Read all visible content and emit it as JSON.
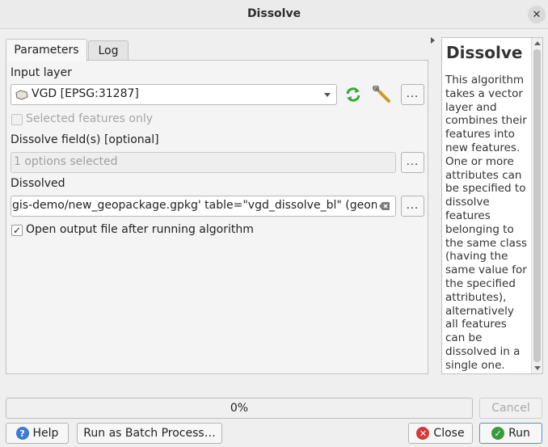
{
  "window": {
    "title": "Dissolve",
    "close_symbol": "✕"
  },
  "tabs": [
    "Parameters",
    "Log"
  ],
  "parameters": {
    "input_layer_label": "Input layer",
    "input_layer_value": "VGD [EPSG:31287]",
    "selected_only_label": "Selected features only",
    "dissolve_field_label": "Dissolve field(s) [optional]",
    "dissolve_field_placeholder": "1 options selected",
    "output_label": "Dissolved",
    "output_value": "gis-demo/new_geopackage.gpkg' table=\"vgd_dissolve_bl\" (geom)",
    "open_output_label": "Open output file after running algorithm",
    "open_output_checked": true,
    "browse_label": "..."
  },
  "help_panel": {
    "title": "Dissolve",
    "text": "This algorithm takes a vector layer and combines their features into new features. One or more attributes can be specified to dissolve features belonging to the same class (having the same value for the specified attributes), alternatively all features can be dissolved in a single one."
  },
  "progress": {
    "label": "0%",
    "value": 0
  },
  "buttons": {
    "cancel": "Cancel",
    "help": "Help",
    "batch": "Run as Batch Process…",
    "close": "Close",
    "run": "Run"
  },
  "colors": {
    "run_icon": "#3a9a3a",
    "close_icon": "#d33a3a",
    "help_icon": "#3c7bd6",
    "refresh_icon": "#3aa63a"
  }
}
